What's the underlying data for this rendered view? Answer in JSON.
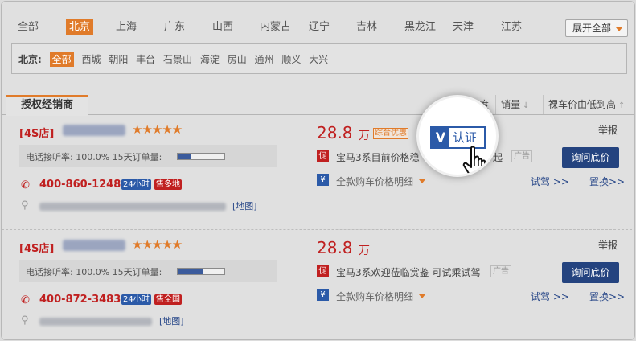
{
  "provinces": [
    {
      "label": "全部"
    },
    {
      "label": "北京",
      "active": true
    },
    {
      "label": "上海"
    },
    {
      "label": "广东"
    },
    {
      "label": "山西"
    },
    {
      "label": "内蒙古"
    },
    {
      "label": "辽宁"
    },
    {
      "label": "吉林"
    },
    {
      "label": "黑龙江"
    },
    {
      "label": "天津"
    },
    {
      "label": "江苏"
    }
  ],
  "expand_label": "展开全部",
  "city_prefix": "北京:",
  "cities": [
    {
      "label": "全部",
      "active": true
    },
    {
      "label": "西城"
    },
    {
      "label": "朝阳"
    },
    {
      "label": "丰台"
    },
    {
      "label": "石景山"
    },
    {
      "label": "海淀"
    },
    {
      "label": "房山"
    },
    {
      "label": "通州"
    },
    {
      "label": "顺义"
    },
    {
      "label": "大兴"
    }
  ],
  "tab_label": "授权经销商",
  "sort": {
    "partial_label": "度",
    "sales_label": "销量",
    "price_label": "裸车价由低到高"
  },
  "listings": [
    {
      "shop_type": "[4S店]",
      "stars": "★★★★★",
      "rating": 5,
      "stats_text": "电话接听率: 100.0% 15天订单量:",
      "order_fill": 0.3,
      "phone": "400-860-1248",
      "badge_24": "24小时",
      "badge_sale": "售多地",
      "map_label": "[地图]",
      "price": "28.8",
      "price_unit": "万",
      "promo_tag": "综合优惠",
      "report": "举报",
      "promo_icon": "促",
      "promo_text": "宝马3系目前价格稳",
      "promo_suffix": "起",
      "ad_label": "广告",
      "inquire": "询问底价",
      "yen_icon": "¥",
      "detail": "全款购车价格明细",
      "test_drive": "试驾 >>",
      "replace": "置换>>"
    },
    {
      "shop_type": "[4S店]",
      "stars": "★★★★★",
      "rating": 5,
      "stats_text": "电话接听率: 100.0% 15天订单量:",
      "order_fill": 0.55,
      "phone": "400-872-3483",
      "badge_24": "24小时",
      "badge_sale": "售全国",
      "map_label": "[地图]",
      "price": "28.8",
      "price_unit": "万",
      "report": "举报",
      "promo_icon": "促",
      "promo_text": "宝马3系欢迎莅临赏鉴 可试乘试驾",
      "ad_label": "广告",
      "inquire": "询问底价",
      "yen_icon": "¥",
      "detail": "全款购车价格明细",
      "test_drive": "试驾 >>",
      "replace": "置换>>"
    }
  ],
  "magnifier": {
    "v_letter": "V",
    "v_text": "认证"
  },
  "icons": {
    "phone": "phone-icon",
    "pin": "location-pin-icon",
    "hand": "hand-cursor-icon"
  },
  "colors": {
    "accent": "#e07b2a",
    "price_red": "#c02020",
    "navy": "#24437f",
    "blue": "#2b5aa8"
  }
}
